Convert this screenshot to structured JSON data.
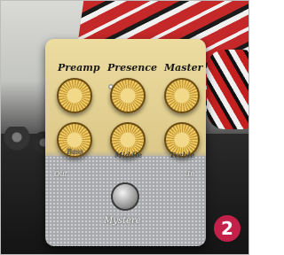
{
  "pedal": {
    "top_labels": [
      "Preamp",
      "Presence",
      "Master"
    ],
    "bottom_labels": [
      "Bass",
      "Middle",
      "Treble"
    ],
    "jack_out": "Out",
    "jack_in": "In",
    "brand": "Mystere"
  },
  "badge": {
    "number": "2",
    "color": "#c4214a"
  }
}
